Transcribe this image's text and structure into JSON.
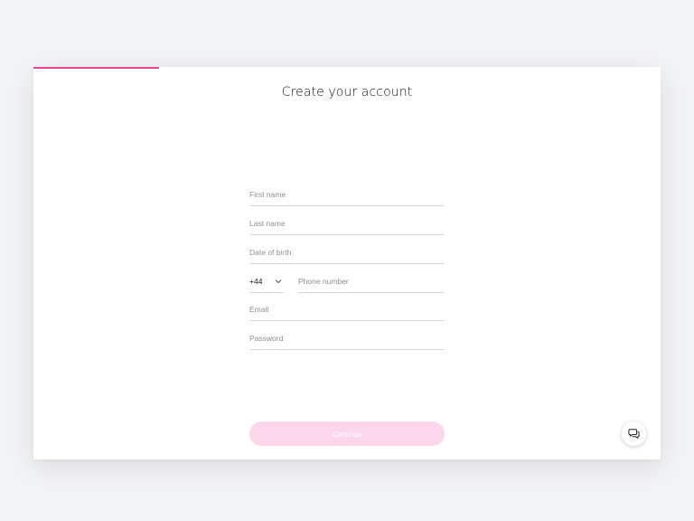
{
  "progress": {
    "fraction": 0.2,
    "color": "#e8469b"
  },
  "page": {
    "title": "Create your account"
  },
  "form": {
    "first_name": {
      "placeholder": "First name",
      "value": ""
    },
    "last_name": {
      "placeholder": "Last name",
      "value": ""
    },
    "date_of_birth": {
      "placeholder": "Date of birth",
      "value": ""
    },
    "phone": {
      "country_code": "+44",
      "placeholder": "Phone number",
      "value": "",
      "dropdown_icon": "chevron-down-icon"
    },
    "email": {
      "placeholder": "Email",
      "value": ""
    },
    "password": {
      "placeholder": "Password",
      "value": ""
    }
  },
  "actions": {
    "continue_label": "Continue",
    "continue_enabled": false,
    "continue_color": "#fbd6ea"
  },
  "chat": {
    "icon": "chat-bubbles-icon"
  }
}
